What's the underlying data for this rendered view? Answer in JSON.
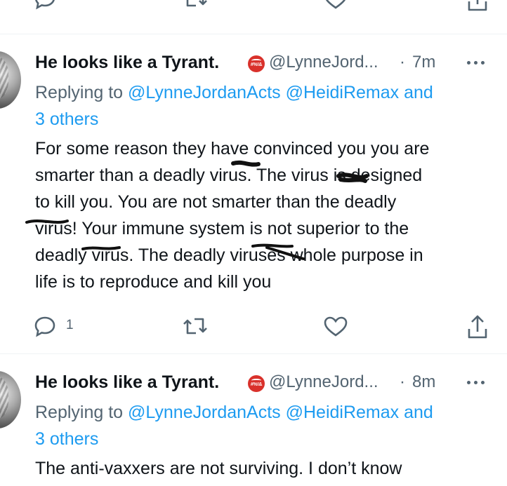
{
  "tweets": [
    {
      "author_name": "He looks like a Tyrant.",
      "badge_text": "#%!&",
      "handle": "@LynneJord...",
      "separator": "·",
      "time": "7m",
      "replying_prefix": "Replying to ",
      "replying_to_1": "@LynneJordanActs",
      "replying_to_2": "@HeidiRemax",
      "replying_and": " and",
      "replying_others": "3 others",
      "lines": [
        "For some reason they have convinced you you are",
        "smarter than a deadly virus. The virus is designed",
        "to kill you. You are not smarter than the deadly",
        "virus! Your immune system is not superior to the",
        "deadly virus. The deadly viruses whole purpose in",
        "life is to reproduce and kill you"
      ],
      "reply_count": "1"
    },
    {
      "author_name": "He looks like a Tyrant.",
      "badge_text": "#%!&",
      "handle": "@LynneJord...",
      "separator": "·",
      "time": "8m",
      "replying_prefix": "Replying to ",
      "replying_to_1": "@LynneJordanActs",
      "replying_to_2": "@HeidiRemax",
      "replying_and": " and",
      "replying_others": "3 others",
      "lines": [
        "The anti-vaxxers are not surviving. I don’t know"
      ]
    }
  ],
  "icons": {
    "reply": "reply-icon",
    "retweet": "retweet-icon",
    "like": "heart-icon",
    "share": "share-icon",
    "more": "more-icon"
  },
  "colors": {
    "link": "#1d9bf0",
    "secondary": "#536471",
    "text": "#0f1419",
    "divider": "#eff3f4",
    "badge": "#d9312b"
  }
}
